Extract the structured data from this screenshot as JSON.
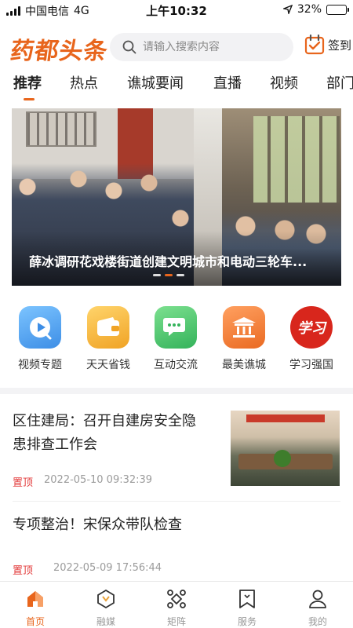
{
  "status_bar": {
    "carrier": "中国电信",
    "network": "4G",
    "time": "上午10:32",
    "battery_percent": "32%",
    "battery_level": 0.32
  },
  "header": {
    "logo_text": "药都头条",
    "search_placeholder": "请输入搜索内容",
    "signin_label": "签到"
  },
  "tabs": [
    {
      "label": "推荐",
      "active": true
    },
    {
      "label": "热点"
    },
    {
      "label": "谯城要闻"
    },
    {
      "label": "直播"
    },
    {
      "label": "视频"
    },
    {
      "label": "部门"
    }
  ],
  "banner": {
    "caption": "薛冰调研花戏楼街道创建文明城市和电动三轮车...",
    "slide_count": 3,
    "active_slide": 1
  },
  "quick_links": [
    {
      "label": "视频专题",
      "icon": "play-icon",
      "color": "#4aa3f0"
    },
    {
      "label": "天天省钱",
      "icon": "wallet-icon",
      "color": "#f5b236"
    },
    {
      "label": "互动交流",
      "icon": "chat-icon",
      "color": "#44c26a"
    },
    {
      "label": "最美谯城",
      "icon": "pavilion-icon",
      "color": "#f07a2e"
    },
    {
      "label": "学习强国",
      "icon": "xuexi-logo",
      "color": "#d8261c",
      "logo_text": "学习"
    }
  ],
  "news": [
    {
      "title_line1": "区住建局：召开自建房安全隐",
      "title_line2": "患排查工作会",
      "tag": "置顶",
      "date": "2022-05-10 09:32:39"
    },
    {
      "title": "专项整治！宋保众带队检查",
      "tag": "置顶",
      "date": "2022-05-09 17:56:44"
    }
  ],
  "tabbar": [
    {
      "label": "首页",
      "icon": "home-icon",
      "active": true
    },
    {
      "label": "融媒",
      "icon": "media-icon"
    },
    {
      "label": "矩阵",
      "icon": "matrix-icon"
    },
    {
      "label": "服务",
      "icon": "service-icon"
    },
    {
      "label": "我的",
      "icon": "profile-icon"
    }
  ],
  "colors": {
    "accent": "#e8651c",
    "tag_red": "#e33c3c"
  }
}
